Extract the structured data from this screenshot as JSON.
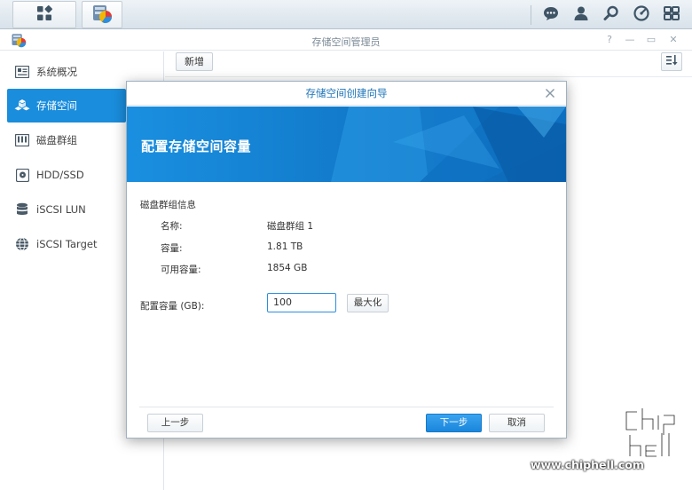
{
  "taskbar": {
    "apps_icon": "grid-icon",
    "active_app_icon": "storage-manager-icon",
    "right_icons": [
      "chat-icon",
      "user-icon",
      "search-icon",
      "widget-icon",
      "desktop-icon"
    ]
  },
  "window": {
    "title": "存储空间管理员",
    "controls": [
      "?",
      "—",
      "▭",
      "✕"
    ]
  },
  "sidebar": {
    "items": [
      {
        "label": "系统概况",
        "icon": "overview-icon",
        "active": false
      },
      {
        "label": "存储空间",
        "icon": "volume-icon",
        "active": true
      },
      {
        "label": "磁盘群组",
        "icon": "disk-group-icon",
        "active": false
      },
      {
        "label": "HDD/SSD",
        "icon": "hdd-icon",
        "active": false
      },
      {
        "label": "iSCSI LUN",
        "icon": "lun-icon",
        "active": false
      },
      {
        "label": "iSCSI Target",
        "icon": "globe-icon",
        "active": false
      }
    ]
  },
  "toolbar": {
    "new_label": "新增",
    "sort_icon": "sort-icon"
  },
  "dialog": {
    "title": "存储空间创建向导",
    "banner_title": "配置存储空间容量",
    "section_title": "磁盘群组信息",
    "info": [
      {
        "key": "名称:",
        "value": "磁盘群组 1"
      },
      {
        "key": "容量:",
        "value": "1.81 TB"
      },
      {
        "key": "可用容量:",
        "value": "1854 GB"
      }
    ],
    "capacity_label": "配置容量 (GB):",
    "capacity_value": "100",
    "max_label": "最大化",
    "prev_label": "上一步",
    "next_label": "下一步",
    "cancel_label": "取消"
  },
  "watermark": {
    "logo_text": "chip hell",
    "url": "www.chiphell.com"
  },
  "colors": {
    "accent": "#1a8ddc",
    "banner": "#1485d6",
    "dialog_title": "#1a72b8"
  }
}
